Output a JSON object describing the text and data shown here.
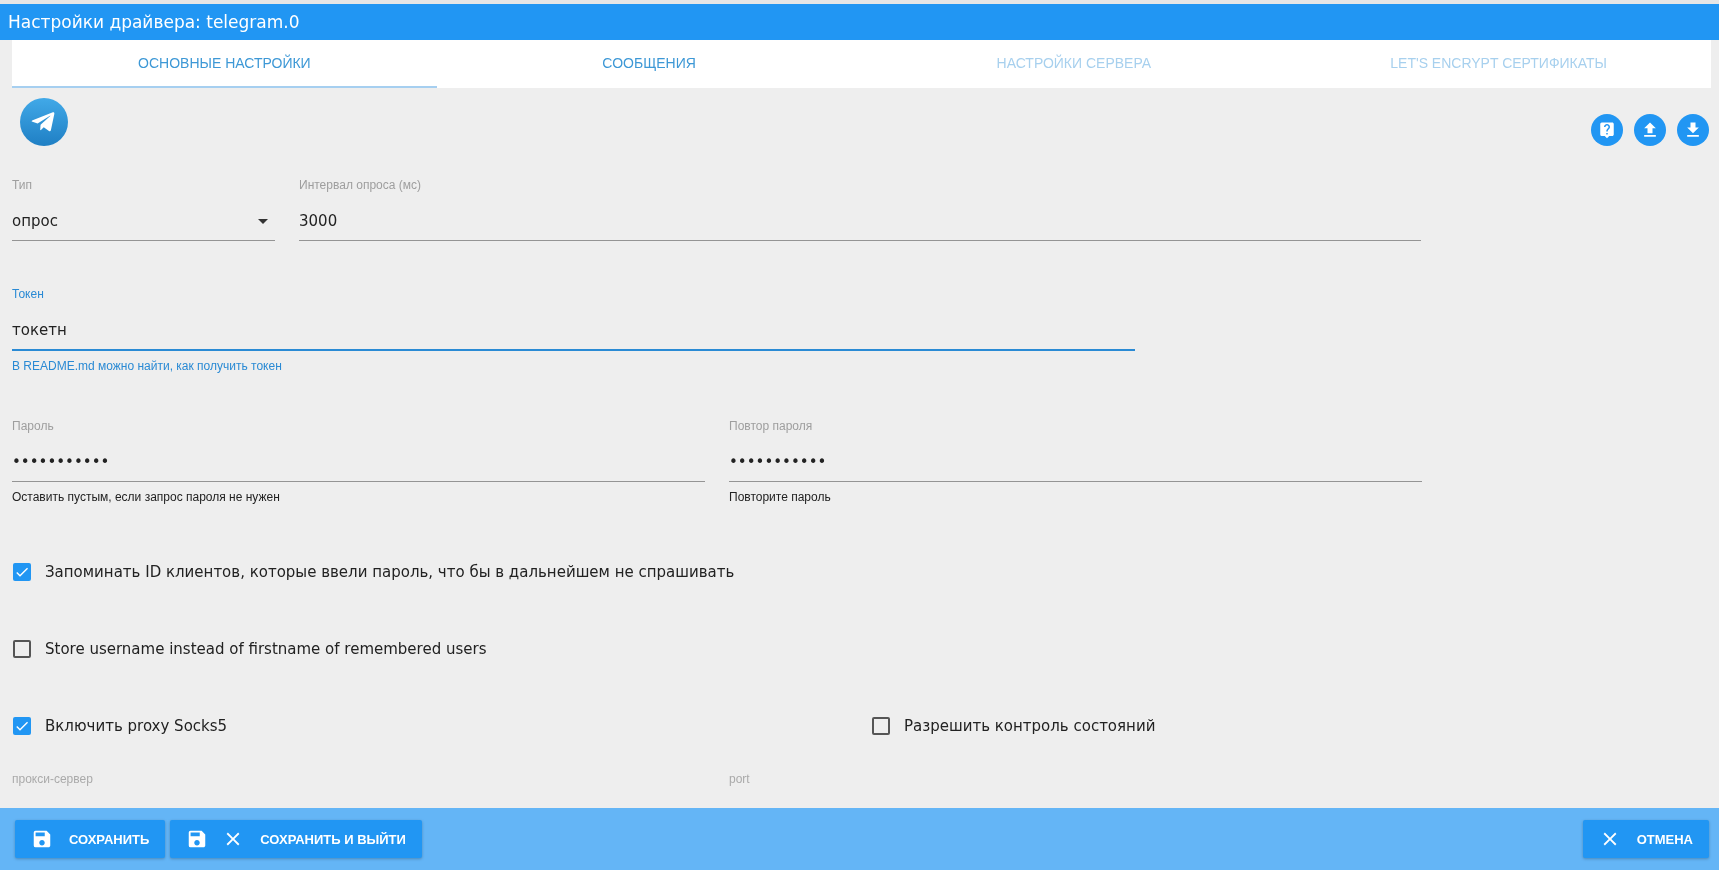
{
  "window": {
    "title": "Настройки драйвера: telegram.0"
  },
  "tabs": [
    {
      "label": "ОСНОВНЫЕ НАСТРОЙКИ",
      "selected": true,
      "disabled": false
    },
    {
      "label": "СООБЩЕНИЯ",
      "selected": false,
      "disabled": false
    },
    {
      "label": "НАСТРОЙКИ СЕРВЕРА",
      "selected": false,
      "disabled": true
    },
    {
      "label": "LET'S ENCRYPT СЕРТИФИКАТЫ",
      "selected": false,
      "disabled": true
    }
  ],
  "toolbar_icons": [
    {
      "kind": "help"
    },
    {
      "kind": "upload"
    },
    {
      "kind": "download"
    }
  ],
  "field_rows": [
    {
      "fields": [
        {
          "kind": "select",
          "label": "Тип",
          "value": "опрос",
          "focused": false
        },
        {
          "kind": "text",
          "label": "Интервал опроса (мс)",
          "value": "3000",
          "focused": false
        }
      ]
    },
    {
      "fields": [
        {
          "kind": "text",
          "label": "Токен",
          "value": "токетн",
          "focused": true,
          "helper": "В README.md можно найти, как получить токен"
        }
      ]
    },
    {
      "fields": [
        {
          "kind": "password",
          "label": "Пароль",
          "value": "•••••••••••",
          "focused": false,
          "helper": "Оставить пустым, если запрос пароля не нужен"
        },
        {
          "kind": "password",
          "label": "Повтор пароля",
          "value": "•••••••••••",
          "focused": false,
          "helper": "Повторите пароль"
        }
      ]
    }
  ],
  "checkbox_rows": [
    {
      "items": [
        {
          "label": "Запоминать ID клиентов, которые ввели пароль, что бы в дальнейшем не спрашивать",
          "checked": true
        }
      ]
    },
    {
      "items": [
        {
          "label": "Store username instead of firstname of remembered users",
          "checked": false
        }
      ]
    },
    {
      "items": [
        {
          "label": "Включить proxy Socks5",
          "checked": true
        },
        {
          "label": "Разрешить контроль состояний",
          "checked": false
        }
      ]
    }
  ],
  "proxy_fields": [
    {
      "label": "прокси-сервер"
    },
    {
      "label": "port"
    }
  ],
  "footer_buttons": [
    {
      "label": "СОХРАНИТЬ"
    },
    {
      "label": "СОХРАНИТЬ И ВЫЙТИ"
    },
    {
      "label": "ОТМЕНА"
    }
  ]
}
